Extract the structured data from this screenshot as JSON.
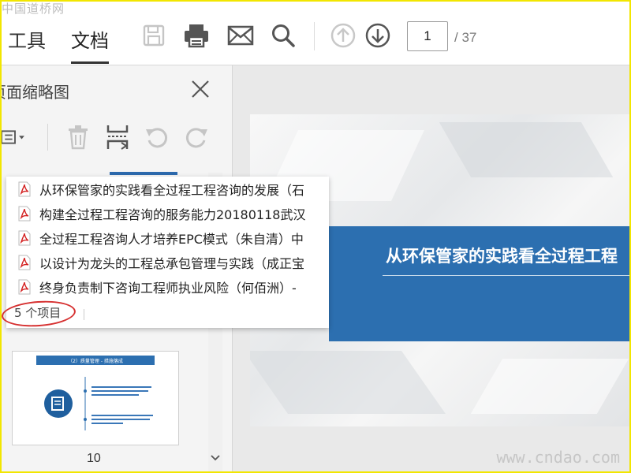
{
  "watermark": {
    "top": "中国道桥网",
    "bottom": "www.cndao.com"
  },
  "toolbar": {
    "tabs": [
      {
        "label": "工具"
      },
      {
        "label": "文档"
      }
    ],
    "page_current": "1",
    "page_total": "/ 37",
    "icons": [
      "save-icon",
      "print-icon",
      "email-icon",
      "search-icon",
      "page-up-icon",
      "page-down-icon"
    ]
  },
  "sidebar": {
    "title": "页面缩略图",
    "tools": [
      "options-menu-icon",
      "trash-icon",
      "extract-icon",
      "rotate-left-icon",
      "rotate-right-icon"
    ],
    "thumbnail": {
      "page_label": "10",
      "title": "（2）质量管理 - 措施落成"
    }
  },
  "document": {
    "banner_title": "从环保管家的实践看全过程工程"
  },
  "file_list": {
    "items": [
      {
        "name": "从环保管家的实践看全过程工程咨询的发展（石"
      },
      {
        "name": "构建全过程工程咨询的服务能力20180118武汉"
      },
      {
        "name": "全过程工程咨询人才培养EPC模式（朱自清）中"
      },
      {
        "name": "以设计为龙头的工程总承包管理与实践（成正宝"
      },
      {
        "name": "终身负责制下咨询工程师执业风险（何佰洲）-"
      }
    ],
    "count_text": "5 个项目"
  },
  "colors": {
    "accent_blue": "#2c6fb0",
    "pdf_red": "#d32020",
    "annotation_red": "#d63030"
  }
}
